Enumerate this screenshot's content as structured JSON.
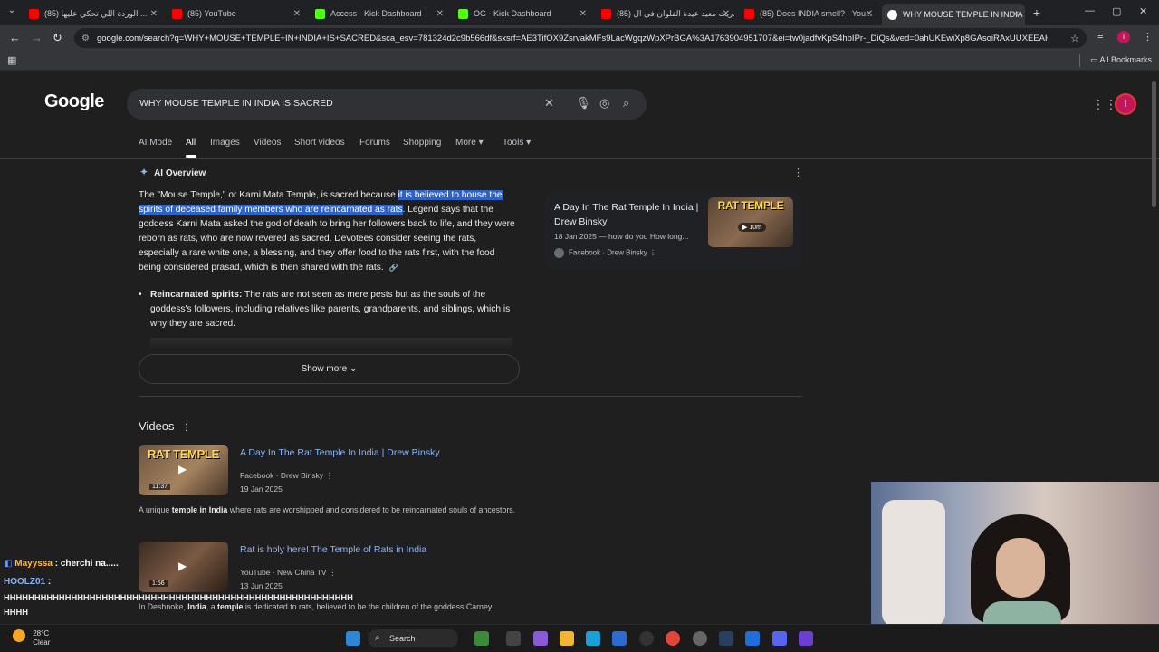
{
  "browser": {
    "tabs": [
      {
        "label": "(85) الوردة اللي تحكي عليها ..."
      },
      {
        "label": "(85) YouTube"
      },
      {
        "label": "Access - Kick Dashboard"
      },
      {
        "label": "OG - Kick Dashboard"
      },
      {
        "label": "(85) ريت معيد عيدة الفلوان في ال..."
      },
      {
        "label": "(85) Does INDIA smell? - You..."
      },
      {
        "label": "WHY MOUSE TEMPLE IN INDIA"
      }
    ],
    "url": "google.com/search?q=WHY+MOUSE+TEMPLE+IN+INDIA+IS+SACRED&sca_esv=781324d2c9b566df&sxsrf=AE3TifOX9ZsrvakMFs9LacWgqzWpXPrBGA%3A1763904951707&ei=tw0jadfvKpS4hbIPr-_DiQs&ved=0ahUKEwiXp8GAsoiRAxUUXEEAHa_3MLEQ4dUDCBE...",
    "all_bookmarks": "All Bookmarks",
    "profile_initial": "i"
  },
  "search": {
    "logo": "Google",
    "query": "WHY MOUSE TEMPLE IN INDIA IS SACRED",
    "tabs": [
      "AI Mode",
      "All",
      "Images",
      "Videos",
      "Short videos",
      "Forums",
      "Shopping",
      "More",
      "Tools"
    ],
    "avatar_initial": "i"
  },
  "ai_overview": {
    "heading": "AI Overview",
    "para_before": "The \"Mouse Temple,\" or Karni Mata Temple, is sacred because ",
    "para_highlight": "it is believed to house the spirits of deceased family members who are reincarnated as rats",
    "para_after": ". Legend says that the goddess Karni Mata asked the god of death to bring her followers back to life, and they were reborn as rats, who are now revered as sacred. Devotees consider seeing the rats, especially a rare white one, a blessing, and they offer food to the rats first, with the food being considered prasad, which is then shared with the rats.",
    "bullet_bold": "Reincarnated spirits:",
    "bullet_text": " The rats are not seen as mere pests but as the souls of the goddess's followers, including relatives like parents, grandparents, and siblings, which is why they are sacred.",
    "show_more": "Show more",
    "card": {
      "title": "A Day In The Rat Temple In India | Drew Binsky",
      "meta": "18 Jan 2025 — how do you How long...",
      "source": "Facebook · Drew Binsky",
      "thumb_text": "RAT TEMPLE",
      "thumb_pill": "10m"
    }
  },
  "videos": {
    "heading": "Videos",
    "items": [
      {
        "title": "A Day In The Rat Temple In India | Drew Binsky",
        "source": "Facebook · Drew Binsky",
        "date": "19 Jan 2025",
        "duration": "11:37",
        "thumb_text": "RAT TEMPLE",
        "desc_a": "A unique ",
        "desc_b1": "temple in India",
        "desc_c": " where rats are worshipped and considered to be reincarnated souls of ancestors."
      },
      {
        "title": "Rat is holy here! The Temple of Rats in India",
        "source": "YouTube · New China TV",
        "date": "13 Jun 2025",
        "duration": "1:56",
        "desc_a": "In Deshnoke, ",
        "desc_b1": "India",
        "desc_b2": ", a ",
        "desc_b3": "temple",
        "desc_c": " is dedicated to rats, believed to be the children of the goddess Carney."
      }
    ]
  },
  "chat": {
    "user1": "Mayyssa",
    "msg1": ": cherchi na.....",
    "user2": "HOOLZ01",
    "msg2": ":",
    "msg2_line2": "HHHHHHHHHHHHHHHHHHHHHHHHHHHHHHHHHHHHHHHHHHHHHHHHHHHHHHHHH",
    "msg2_line3": "HHHH"
  },
  "taskbar": {
    "temp": "28°C",
    "weather": "Clear",
    "search": "Search"
  }
}
